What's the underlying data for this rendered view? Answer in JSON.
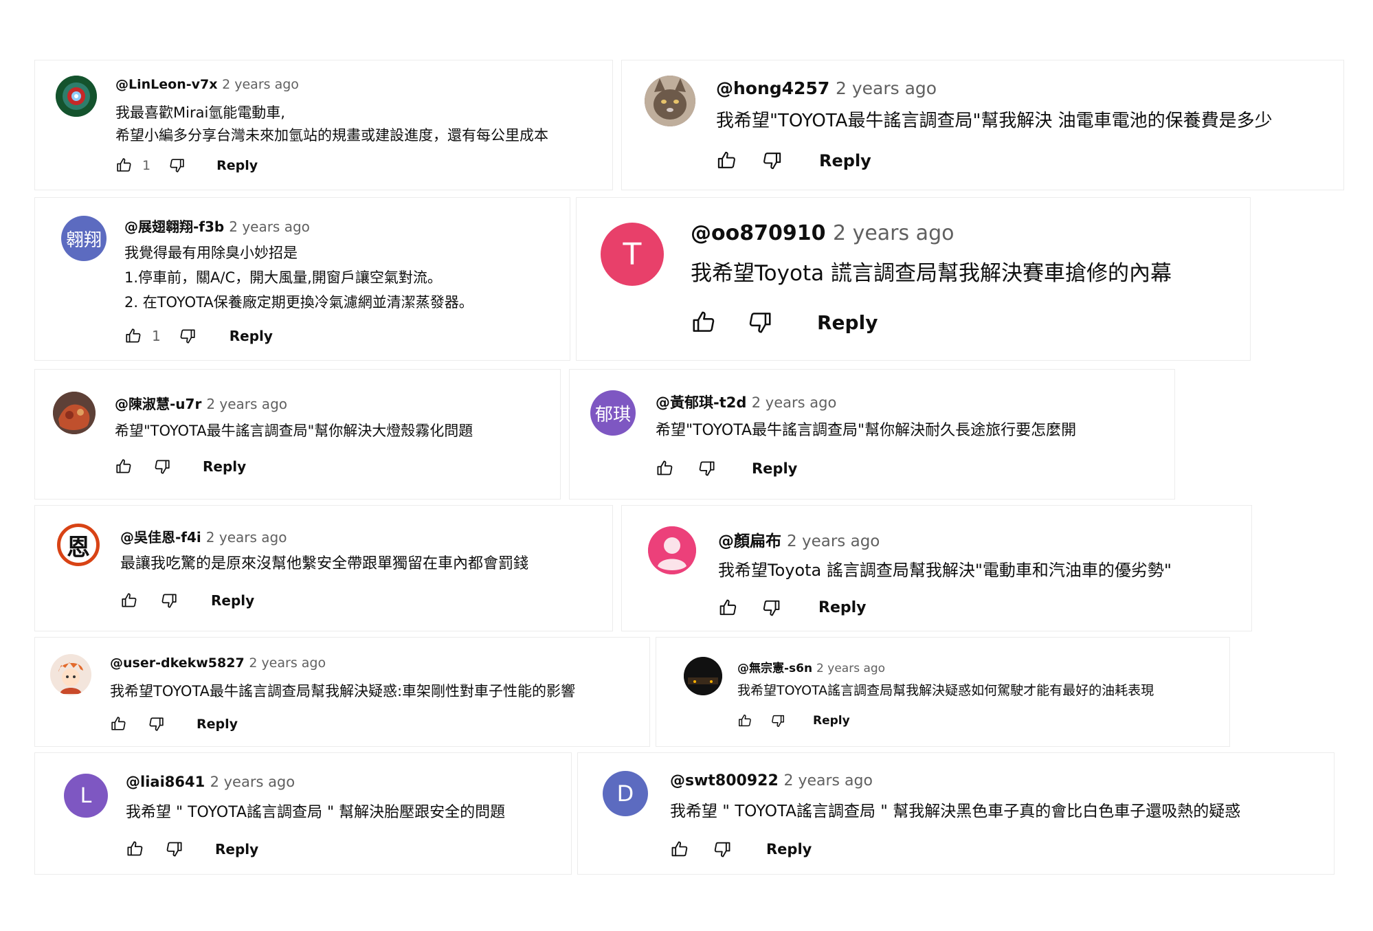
{
  "comments": [
    {
      "author": "@LinLeon-v7x",
      "time": "2 years ago",
      "lines": [
        "我最喜歡Mirai氫能電動車,",
        "希望小編多分享台灣未來加氫站的規畫或建設進度，還有每公里成本"
      ],
      "likes": "1",
      "reply": "Reply"
    },
    {
      "author": "@hong4257",
      "time": "2 years ago",
      "lines": [
        "我希望\"TOYOTA最牛謠言調查局\"幫我解決 油電車電池的保養費是多少"
      ],
      "likes": "",
      "reply": "Reply"
    },
    {
      "author": "@展翅翱翔-f3b",
      "time": "2 years ago",
      "avatar_text": "翱翔",
      "lines": [
        "我覺得最有用除臭小妙招是",
        "1.停車前，關A/C，開大風量,開窗戶讓空氣對流。",
        "2. 在TOYOTA保養廠定期更換冷氣濾網並清潔蒸發器。"
      ],
      "likes": "1",
      "reply": "Reply"
    },
    {
      "author": "@oo870910",
      "time": "2 years ago",
      "avatar_text": "T",
      "lines": [
        "我希望Toyota 謊言調查局幫我解決賽車搶修的內幕"
      ],
      "likes": "",
      "reply": "Reply"
    },
    {
      "author": "@陳淑慧-u7r",
      "time": "2 years ago",
      "lines": [
        "希望\"TOYOTA最牛謠言調查局\"幫你解決大燈殼霧化問題"
      ],
      "likes": "",
      "reply": "Reply"
    },
    {
      "author": "@黃郁琪-t2d",
      "time": "2 years ago",
      "avatar_text": "郁琪",
      "lines": [
        "希望\"TOYOTA最牛謠言調查局\"幫你解決耐久長途旅行要怎麼開"
      ],
      "likes": "",
      "reply": "Reply"
    },
    {
      "author": "@吳佳恩-f4i",
      "time": "2 years ago",
      "avatar_text": "恩",
      "lines": [
        "最讓我吃驚的是原來沒幫他繫安全帶跟單獨留在車內都會罰錢"
      ],
      "likes": "",
      "reply": "Reply"
    },
    {
      "author": "@顏扁布",
      "time": "2 years ago",
      "lines": [
        "我希望Toyota 謠言調查局幫我解決\"電動車和汽油車的優劣勢\""
      ],
      "likes": "",
      "reply": "Reply"
    },
    {
      "author": "@user-dkekw5827",
      "time": "2 years ago",
      "lines": [
        "我希望TOYOTA最牛謠言調查局幫我解決疑惑:車架剛性對車子性能的影響"
      ],
      "likes": "",
      "reply": "Reply"
    },
    {
      "author": "@無宗憲-s6n",
      "time": "2 years ago",
      "lines": [
        "我希望TOYOTA謠言調查局幫我解決疑惑如何駕駛才能有最好的油耗表現"
      ],
      "likes": "",
      "reply": "Reply"
    },
    {
      "author": "@liai8641",
      "time": "2 years ago",
      "avatar_text": "L",
      "lines": [
        "我希望 \" TOYOTA謠言調查局 \" 幫解決胎壓跟安全的問題"
      ],
      "likes": "",
      "reply": "Reply"
    },
    {
      "author": "@swt800922",
      "time": "2 years ago",
      "avatar_text": "D",
      "lines": [
        "我希望 \" TOYOTA謠言調查局 \" 幫我解決黑色車子真的會比白色車子還吸熱的疑惑"
      ],
      "likes": "",
      "reply": "Reply"
    }
  ],
  "icons": {
    "like": "thumbs-up-icon",
    "dislike": "thumbs-down-icon"
  },
  "colors": {
    "avatar_T": "#e8406a",
    "avatar_L": "#7e57c2",
    "avatar_D": "#5c6bc0",
    "avatar_fly": "#5c6bc0",
    "avatar_yu": "#7e57c2",
    "avatar_pink": "#ec407a"
  }
}
